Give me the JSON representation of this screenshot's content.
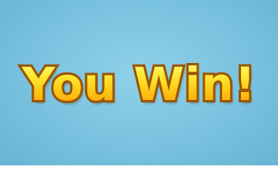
{
  "game": {
    "result_message": "You Win!"
  },
  "colors": {
    "background": "#79c3e0",
    "text_fill_top": "#fffb9a",
    "text_fill_bottom": "#f59a04",
    "text_outline": "#9a5504"
  }
}
